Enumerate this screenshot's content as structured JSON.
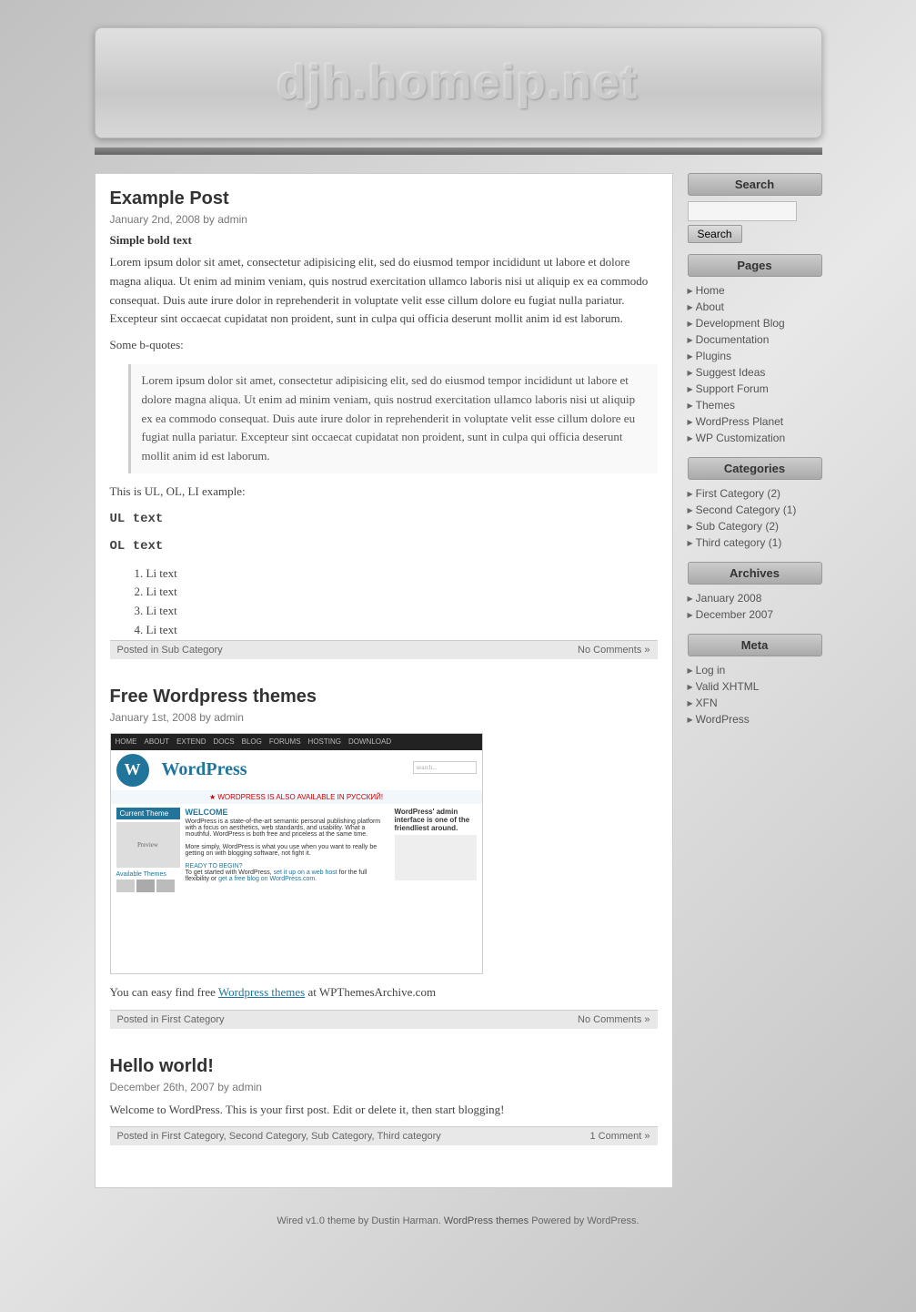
{
  "site": {
    "title": "djh.homeip.net"
  },
  "footer": {
    "text": "Wired v1.0",
    "theme_by": "theme by Dustin Harman.",
    "wp_themes": "WordPress themes",
    "powered": "Powered by WordPress."
  },
  "sidebar": {
    "search_label": "Search",
    "search_button": "Search",
    "pages_label": "Pages",
    "categories_label": "Categories",
    "archives_label": "Archives",
    "meta_label": "Meta",
    "pages_items": [
      {
        "label": "Home",
        "href": "#"
      },
      {
        "label": "About",
        "href": "#"
      },
      {
        "label": "Development Blog",
        "href": "#"
      },
      {
        "label": "Documentation",
        "href": "#"
      },
      {
        "label": "Plugins",
        "href": "#"
      },
      {
        "label": "Suggest Ideas",
        "href": "#"
      },
      {
        "label": "Support Forum",
        "href": "#"
      },
      {
        "label": "Themes",
        "href": "#"
      },
      {
        "label": "WordPress Planet",
        "href": "#"
      },
      {
        "label": "WP Customization",
        "href": "#"
      }
    ],
    "categories_items": [
      {
        "label": "First Category (2)",
        "href": "#"
      },
      {
        "label": "Second Category (1)",
        "href": "#"
      },
      {
        "label": "Sub Category (2)",
        "href": "#"
      },
      {
        "label": "Third category (1)",
        "href": "#"
      }
    ],
    "archives_items": [
      {
        "label": "January 2008",
        "href": "#"
      },
      {
        "label": "December 2007",
        "href": "#"
      }
    ],
    "meta_items": [
      {
        "label": "Log in",
        "href": "#"
      },
      {
        "label": "Valid XHTML",
        "href": "#"
      },
      {
        "label": "XFN",
        "href": "#"
      },
      {
        "label": "WordPress",
        "href": "#"
      }
    ]
  },
  "posts": [
    {
      "id": "post1",
      "title": "Example Post",
      "meta": "January 2nd, 2008 by admin",
      "bold_text": "Simple bold text",
      "paragraph1": "Lorem ipsum dolor sit amet, consectetur adipisicing elit, sed do eiusmod tempor incididunt ut labore et dolore magna aliqua. Ut enim ad minim veniam, quis nostrud exercitation ullamco laboris nisi ut aliquip ex ea commodo consequat. Duis aute irure dolor in reprehenderit in voluptate velit esse cillum dolore eu fugiat nulla pariatur. Excepteur sint occaecat cupidatat non proident, sunt in culpa qui officia deserunt mollit anim id est laborum.",
      "bquotes_label": "Some b-quotes:",
      "blockquote": "Lorem ipsum dolor sit amet, consectetur adipisicing elit, sed do eiusmod tempor incididunt ut labore et dolore magna aliqua. Ut enim ad minim veniam, quis nostrud exercitation ullamco laboris nisi ut aliquip ex ea commodo consequat. Duis aute irure dolor in reprehenderit in voluptate velit esse cillum dolore eu fugiat nulla pariatur. Excepteur sint occaecat cupidatat non proident, sunt in culpa qui officia deserunt mollit anim id est laborum.",
      "ul_ol_label": "This is UL, OL, LI example:",
      "ul_label": "UL text",
      "ol_label": "OL text",
      "li_items": [
        "Li text",
        "Li text",
        "Li text",
        "Li text"
      ],
      "footer_category": "Posted in Sub Category",
      "footer_comments": "No Comments »"
    },
    {
      "id": "post2",
      "title": "Free Wordpress themes",
      "meta": "January 1st, 2008 by admin",
      "content": "You can easy find free",
      "link_text": "Wordpress themes",
      "content2": "at WPThemesArchive.com",
      "footer_category": "Posted in First Category",
      "footer_comments": "No Comments »"
    },
    {
      "id": "post3",
      "title": "Hello world!",
      "meta": "December 26th, 2007 by admin",
      "paragraph1": "Welcome to WordPress. This is your first post. Edit or delete it, then start blogging!",
      "footer_category": "Posted in First Category, Second Category, Sub Category, Third category",
      "footer_comments": "1 Comment »"
    }
  ]
}
